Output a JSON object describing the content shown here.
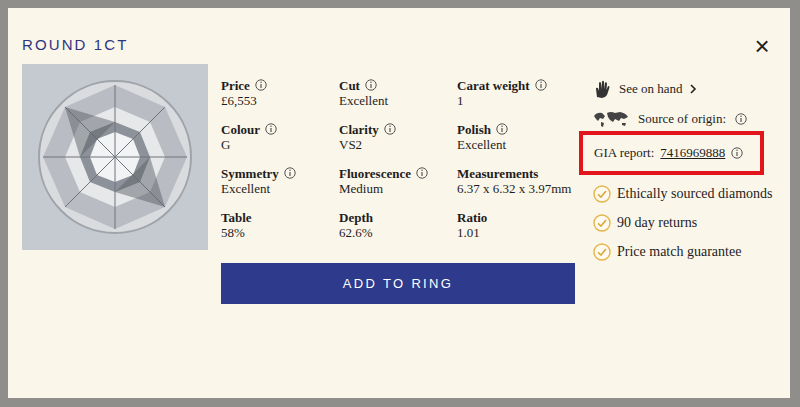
{
  "modal": {
    "title": "ROUND 1CT",
    "close": "×"
  },
  "specs": [
    {
      "label": "Price",
      "value": "£6,553",
      "info": true
    },
    {
      "label": "Cut",
      "value": "Excellent",
      "info": true
    },
    {
      "label": "Carat weight",
      "value": "1",
      "info": true
    },
    {
      "label": "Colour",
      "value": "G",
      "info": true
    },
    {
      "label": "Clarity",
      "value": "VS2",
      "info": true
    },
    {
      "label": "Polish",
      "value": "Excellent",
      "info": true
    },
    {
      "label": "Symmetry",
      "value": "Excellent",
      "info": true
    },
    {
      "label": "Fluorescence",
      "value": "Medium",
      "info": true
    },
    {
      "label": "Measurements",
      "value": "6.37 x 6.32 x 3.97mm",
      "info": false
    },
    {
      "label": "Table",
      "value": "58%",
      "info": false
    },
    {
      "label": "Depth",
      "value": "62.6%",
      "info": false
    },
    {
      "label": "Ratio",
      "value": "1.01",
      "info": false
    }
  ],
  "button": "ADD TO RING",
  "see_on_hand": "See on hand",
  "source_of_origin": "Source of origin:",
  "gia": {
    "label": "GIA report:",
    "number": "7416969888",
    "highlighted": true
  },
  "features": [
    "Ethically sourced diamonds",
    "90 day returns",
    "Price match guarantee"
  ]
}
